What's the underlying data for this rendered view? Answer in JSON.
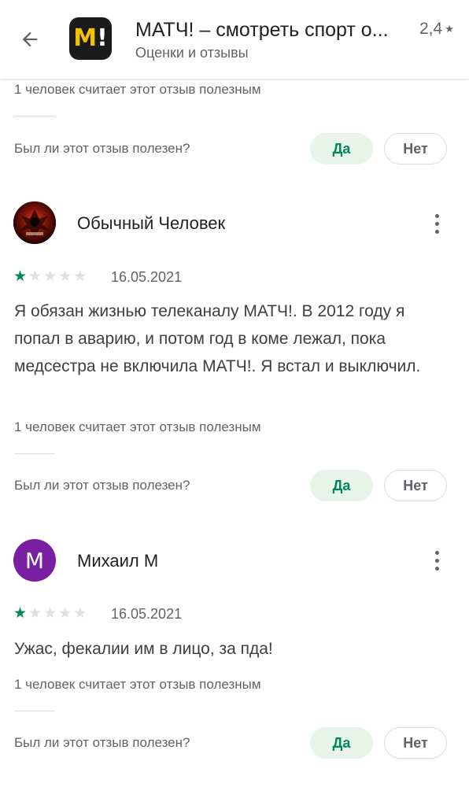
{
  "header": {
    "back_icon": "arrow-back-icon",
    "app_logo": {
      "letter": "M",
      "mark": "!"
    },
    "title": "МАТЧ! – смотреть спорт о...",
    "rating": "2,4",
    "rating_icon": "star-icon",
    "subtitle": "Оценки и отзывы"
  },
  "top_partial_review": {
    "helpful_count": "1 человек считает этот отзыв полезным",
    "helpful_question": "Был ли этот отзыв полезен?",
    "yes_label": "Да",
    "no_label": "Нет"
  },
  "reviews": [
    {
      "author": "Обычный Человек",
      "avatar_type": "image",
      "rating": 1,
      "max_rating": 5,
      "date": "16.05.2021",
      "text": "Я обязан жизнью телеканалу МАТЧ!. В 2012 году я попал в аварию, и потом год в коме лежал, пока медсестра не включила МАТЧ!. Я встал и выключил.",
      "helpful_count": "1 человек считает этот отзыв полезным",
      "helpful_question": "Был ли этот отзыв полезен?",
      "yes_label": "Да",
      "no_label": "Нет"
    },
    {
      "author": "Михаил М",
      "avatar_type": "letter",
      "avatar_letter": "M",
      "avatar_color": "#7b1fa2",
      "rating": 1,
      "max_rating": 5,
      "date": "16.05.2021",
      "text": "Ужас, фекалии им в лицо, за пда!",
      "helpful_count": "1 человек считает этот отзыв полезным",
      "helpful_question": "Был ли этот отзыв полезен?",
      "yes_label": "Да",
      "no_label": "Нет"
    }
  ],
  "colors": {
    "accent_green": "#01875f",
    "yes_bg": "#e6f4ea",
    "secondary_text": "#5f6368",
    "star_empty": "#e0e0e0"
  }
}
